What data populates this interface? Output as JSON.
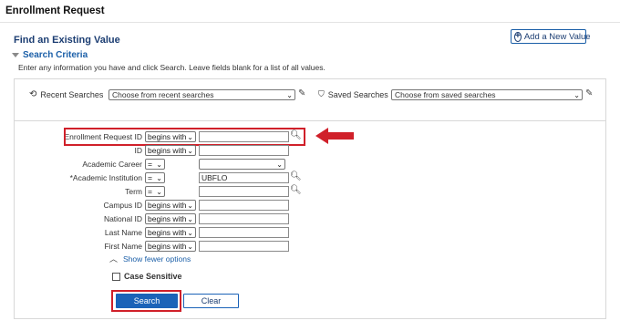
{
  "page": {
    "title": "Enrollment Request",
    "find_title": "Find an Existing Value",
    "add_new_label": "Add a New Value",
    "criteria_label": "Search Criteria",
    "instructions": "Enter any information you have and click Search. Leave fields blank for a list of all values."
  },
  "recent": {
    "recent_label": "Recent Searches",
    "recent_placeholder": "Choose from recent searches",
    "saved_label": "Saved Searches",
    "saved_placeholder": "Choose from saved searches"
  },
  "fields": [
    {
      "label": "Enrollment Request ID",
      "operator": "begins with",
      "value": ""
    },
    {
      "label": "ID",
      "operator": "begins with",
      "value": ""
    },
    {
      "label": "Academic Career",
      "operator": "=",
      "value": ""
    },
    {
      "label": "*Academic Institution",
      "operator": "=",
      "value": "UBFLO"
    },
    {
      "label": "Term",
      "operator": "=",
      "value": ""
    },
    {
      "label": "Campus ID",
      "operator": "begins with",
      "value": ""
    },
    {
      "label": "National ID",
      "operator": "begins with",
      "value": ""
    },
    {
      "label": "Last Name",
      "operator": "begins with",
      "value": ""
    },
    {
      "label": "First Name",
      "operator": "begins with",
      "value": ""
    }
  ],
  "options": {
    "show_fewer": "Show fewer options",
    "case_sensitive": "Case Sensitive"
  },
  "buttons": {
    "search": "Search",
    "clear": "Clear"
  },
  "colors": {
    "accent": "#1b63b8",
    "annotation_red": "#d0202a"
  }
}
